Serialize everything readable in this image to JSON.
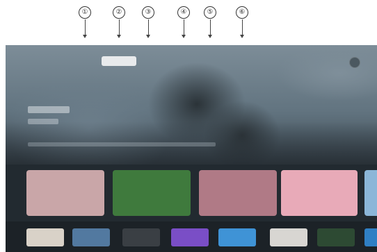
{
  "callouts": [
    "①",
    "②",
    "③",
    "④",
    "⑤",
    "⑥"
  ],
  "nav": {
    "tabs": [
      {
        "label": "",
        "active": false
      },
      {
        "label": "",
        "active": true
      },
      {
        "label": "",
        "active": false
      },
      {
        "label": "",
        "active": false
      },
      {
        "label": "",
        "active": false
      },
      {
        "label": "",
        "active": false
      }
    ]
  },
  "colors": {
    "screen_bg": "#5c6e7c",
    "active_tab_bg": "#e8eaec",
    "row_bg": "#222a30"
  },
  "cards": [
    {
      "name": "card-1",
      "color": "#c9a6a8"
    },
    {
      "name": "card-2",
      "color": "#3f7a3d"
    },
    {
      "name": "card-3",
      "color": "#b07a86"
    },
    {
      "name": "card-4",
      "color": "#e8aab8"
    },
    {
      "name": "card-5",
      "color": "#8bb6d8"
    }
  ],
  "apps": [
    {
      "name": "app-1",
      "color": "#d9d2c8"
    },
    {
      "name": "app-2",
      "color": "#5279a0"
    },
    {
      "name": "app-3",
      "color": "#3a3f44"
    },
    {
      "name": "app-4",
      "color": "#7a4ec6"
    },
    {
      "name": "app-5",
      "color": "#3f93d6"
    },
    {
      "name": "app-6",
      "color": "#d8d6d2"
    },
    {
      "name": "app-7",
      "color": "#2d4a33"
    },
    {
      "name": "app-8",
      "color": "#2f7fc4"
    }
  ]
}
